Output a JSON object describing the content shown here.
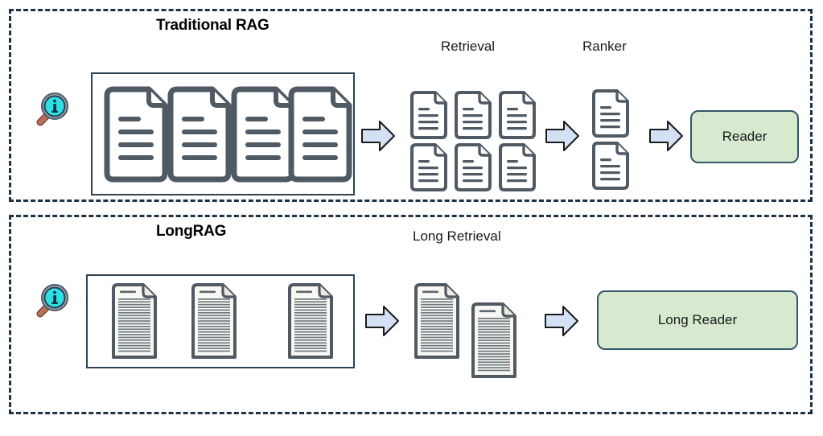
{
  "figure": {
    "type": "diagram",
    "subject": "Comparison of Traditional RAG and LongRAG pipelines"
  },
  "panels": [
    {
      "id": "traditional-rag",
      "title": "Traditional RAG",
      "query_icon": "magnifier-info-icon",
      "corpus": {
        "doc_count": 4,
        "doc_style": "short-document"
      },
      "stages": [
        {
          "label": "Retrieval",
          "doc_count": 6,
          "layout": "3x2-grid"
        },
        {
          "label": "Ranker",
          "doc_count": 2,
          "layout": "1x2-column"
        }
      ],
      "reader": {
        "label": "Reader"
      },
      "arrow_count": 3
    },
    {
      "id": "longrag",
      "title": "LongRAG",
      "query_icon": "magnifier-info-icon",
      "corpus": {
        "doc_count": 3,
        "doc_style": "long-document"
      },
      "stages": [
        {
          "label": "Long Retrieval",
          "doc_count": 2,
          "layout": "offset-pair"
        }
      ],
      "reader": {
        "label": "Long Reader"
      },
      "arrow_count": 2
    }
  ],
  "colors": {
    "panel_border": "#1d3244",
    "box_border": "#2c4356",
    "arrow_fill": "#d4e1f4",
    "arrow_border": "#1a1a1a",
    "reader_fill": "#d7ead0",
    "reader_border": "#34566b",
    "doc_outline": "#4a5560",
    "doc_fill": "#fbfbfa",
    "lens_fill": "#2ee0e6",
    "handle_fill": "#a8604a",
    "text": "#1a1a1a"
  },
  "icons": {
    "magnifier": "magnifier-info-icon",
    "document_short": "document-icon",
    "document_long": "long-document-icon",
    "arrow": "arrow-right-icon"
  }
}
